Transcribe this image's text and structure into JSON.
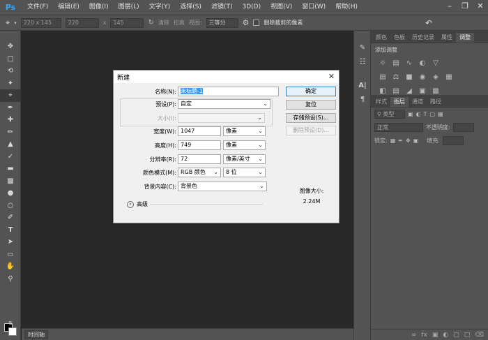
{
  "app": {
    "logo": "Ps",
    "menu": [
      "文件(F)",
      "编辑(E)",
      "图像(I)",
      "图层(L)",
      "文字(Y)",
      "选择(S)",
      "滤镜(T)",
      "3D(D)",
      "视图(V)",
      "窗口(W)",
      "帮助(H)"
    ],
    "window_controls": [
      "minimize-icon",
      "restore-icon",
      "close-icon"
    ]
  },
  "options_bar": {
    "crop_preset": "220 x 145",
    "width_value": "220",
    "x_label": "x",
    "height_value": "145",
    "clear_label": "清除",
    "straighten_label": "拉直",
    "view_label": "视图:",
    "view_value": "三等分",
    "delete_cropped_label": "删除裁剪的像素"
  },
  "timeline": {
    "tab_label": "时间轴"
  },
  "panels": {
    "top_tabs": [
      "颜色",
      "色板",
      "历史记录",
      "属性",
      "调整"
    ],
    "active_top_tab": "调整",
    "adjust_label": "添加调整",
    "bottom_tabs": [
      "样式",
      "图层",
      "通道",
      "路径"
    ],
    "active_bottom_tab": "图层",
    "filter_kind": "类型",
    "blend_mode": "正常",
    "opacity_label": "不透明度:",
    "lock_label": "锁定:",
    "fill_label": "填充:"
  },
  "dialog": {
    "title": "新建",
    "name_label": "名称(N):",
    "name_value": "未标题-1",
    "preset_label": "预设(P):",
    "preset_value": "自定",
    "size_label": "大小(I):",
    "width_label": "宽度(W):",
    "width_value": "1047",
    "width_unit": "像素",
    "height_label": "高度(H):",
    "height_value": "749",
    "height_unit": "像素",
    "resolution_label": "分辨率(R):",
    "resolution_value": "72",
    "resolution_unit": "像素/英寸",
    "color_mode_label": "颜色模式(M):",
    "color_mode_value": "RGB 颜色",
    "bit_depth_value": "8 位",
    "bg_label": "背景内容(C):",
    "bg_value": "背景色",
    "advanced_label": "高级",
    "ok_button": "确定",
    "reset_button": "复位",
    "save_preset_button": "存储预设(S)...",
    "delete_preset_button": "删除预设(D)...",
    "image_size_label": "图像大小:",
    "image_size_value": "2.24M"
  },
  "colors": {
    "ui_gray": "#535353",
    "canvas": "#282828",
    "dialog_bg": "#f0f0f0",
    "selection": "#3399ff",
    "ps_blue": "#31a8ff"
  }
}
